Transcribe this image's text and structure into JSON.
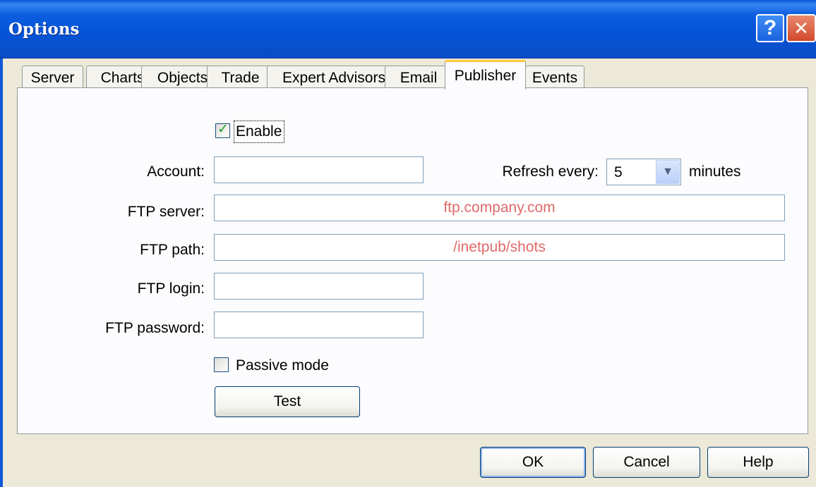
{
  "window": {
    "title": "Options",
    "help_glyph": "?",
    "close_glyph": "✕"
  },
  "tabs": [
    {
      "label": "Server"
    },
    {
      "label": "Charts"
    },
    {
      "label": "Objects"
    },
    {
      "label": "Trade"
    },
    {
      "label": "Expert Advisors"
    },
    {
      "label": "Email"
    },
    {
      "label": "Publisher",
      "active": true
    },
    {
      "label": "Events"
    }
  ],
  "publisher": {
    "enable_label": "Enable",
    "enable_checked": true,
    "account_label": "Account:",
    "account_value": "",
    "refresh_label": "Refresh every:",
    "refresh_value": "5",
    "minutes_label": "minutes",
    "ftp_server_label": "FTP server:",
    "ftp_server_placeholder": "ftp.company.com",
    "ftp_path_label": "FTP path:",
    "ftp_path_placeholder": "/inetpub/shots",
    "ftp_login_label": "FTP login:",
    "ftp_login_value": "",
    "ftp_password_label": "FTP password:",
    "ftp_password_value": "",
    "passive_label": "Passive mode",
    "passive_checked": false,
    "test_label": "Test"
  },
  "footer": {
    "ok_label": "OK",
    "cancel_label": "Cancel",
    "help_label": "Help"
  },
  "colors": {
    "titlebar": "#0653d6",
    "placeholder_text": "#e06a6a",
    "active_tab_accent": "#ffc83c"
  },
  "icons": {
    "help": "help-icon",
    "close": "close-icon",
    "dropdown": "chevron-down-icon",
    "check": "checkmark-icon"
  }
}
